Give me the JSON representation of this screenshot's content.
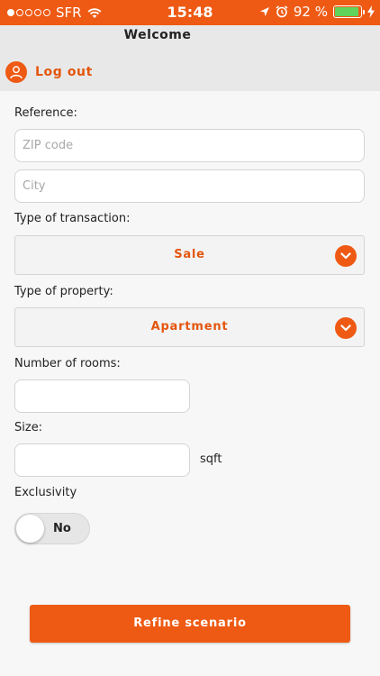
{
  "status_bar": {
    "carrier": "SFR",
    "time": "15:48",
    "battery": "92 %",
    "battery_level": 0.92
  },
  "header": {
    "title": "Welcome",
    "logout_label": "Log out"
  },
  "form": {
    "reference_label": "Reference:",
    "zip_placeholder": "ZIP code",
    "city_placeholder": "City",
    "transaction_label": "Type of transaction:",
    "transaction_value": "Sale",
    "property_label": "Type of property:",
    "property_value": "Apartment",
    "rooms_label": "Number of rooms:",
    "size_label": "Size:",
    "size_unit": "sqft",
    "exclusivity_label": "Exclusivity",
    "exclusivity_value": "No"
  },
  "actions": {
    "refine_label": "Refine scenario"
  },
  "colors": {
    "accent": "#ee5a14",
    "battery": "#5fd35a"
  }
}
